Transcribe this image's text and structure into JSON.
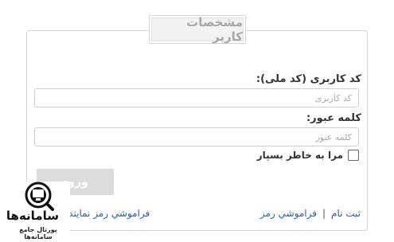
{
  "panel": {
    "title": "مشخصات کاربر"
  },
  "form": {
    "username_label": "کد کاربری (کد ملی):",
    "username_placeholder": "کد کاربری",
    "password_label": "کلمه عبور:",
    "password_placeholder": "کلمه عبور",
    "remember_label": "مرا به خاطر بسپار",
    "remember_checked": false,
    "submit_label": "ورود"
  },
  "links": {
    "register": "ثبت نام",
    "separator": "|",
    "forgot_password": "فراموشي رمز",
    "forgot_representative": "فراموشي رمز نمايندگان"
  },
  "watermark": {
    "name": "سامانه‌ها",
    "tagline": "پورتال جامع سامانه‌ها",
    "icon": "search-monitor-icon"
  }
}
